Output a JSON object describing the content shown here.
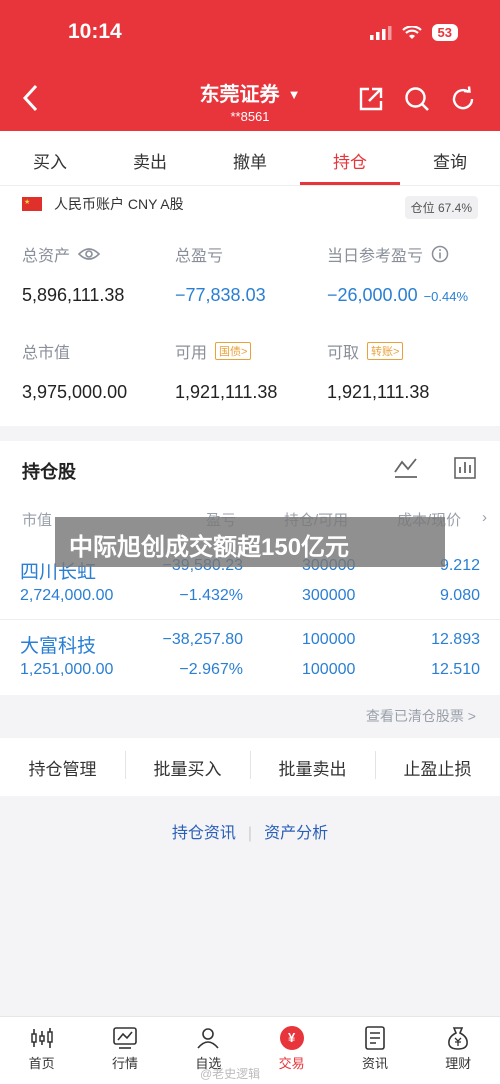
{
  "status_bar": {
    "time": "10:14",
    "battery": "53"
  },
  "header": {
    "broker": "东莞证券",
    "account": "**8561"
  },
  "tabs": [
    {
      "label": "买入"
    },
    {
      "label": "卖出"
    },
    {
      "label": "撤单"
    },
    {
      "label": "持仓",
      "active": true
    },
    {
      "label": "查询"
    }
  ],
  "account": {
    "currency": "人民币账户 CNY A股",
    "position_ratio": "仓位 67.4%",
    "total_assets_label": "总资产",
    "total_assets": "5,896,111.38",
    "total_pnl_label": "总盈亏",
    "total_pnl": "−77,838.03",
    "daily_pnl_label": "当日参考盈亏",
    "daily_pnl": "−26,000.00",
    "daily_pnl_pct": "−0.44%",
    "market_value_label": "总市值",
    "market_value": "3,975,000.00",
    "available_label": "可用",
    "available_tag": "国债>",
    "available": "1,921,111.38",
    "withdrawable_label": "可取",
    "withdrawable_tag": "转账>",
    "withdrawable": "1,921,111.38"
  },
  "positions": {
    "title": "持仓股",
    "columns": {
      "market_value": "市值",
      "pnl": "盈亏",
      "hold": "持仓/可用",
      "cost": "成本/现价"
    },
    "rows": [
      {
        "name": "四川长虹",
        "market_value": "2,724,000.00",
        "pnl": "−39,580.23",
        "pnl_pct": "−1.432%",
        "hold": "300000",
        "available": "300000",
        "cost": "9.212",
        "price": "9.080"
      },
      {
        "name": "大富科技",
        "market_value": "1,251,000.00",
        "pnl": "−38,257.80",
        "pnl_pct": "−2.967%",
        "hold": "100000",
        "available": "100000",
        "cost": "12.893",
        "price": "12.510"
      }
    ],
    "cleared_link": "查看已清仓股票 >"
  },
  "actions": [
    "持仓管理",
    "批量买入",
    "批量卖出",
    "止盈止损"
  ],
  "links": {
    "news": "持仓资讯",
    "analysis": "资产分析"
  },
  "overlay_text": "中际旭创成交额超150亿元",
  "bottom_nav": [
    {
      "label": "首页",
      "icon": "candlestick-icon"
    },
    {
      "label": "行情",
      "icon": "chart-icon"
    },
    {
      "label": "自选",
      "icon": "person-icon"
    },
    {
      "label": "交易",
      "icon": "yuan-icon",
      "active": true
    },
    {
      "label": "资讯",
      "icon": "document-icon"
    },
    {
      "label": "理财",
      "icon": "moneybag-icon"
    }
  ],
  "watermark": "@老史逻辑"
}
